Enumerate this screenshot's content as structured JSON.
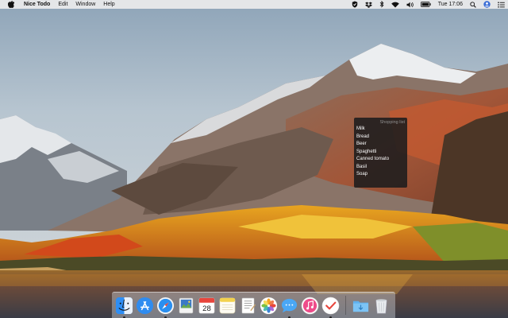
{
  "menubar": {
    "app_name": "Nice Todo",
    "menus": [
      "Edit",
      "Window",
      "Help"
    ],
    "clock": "Tue 17:06",
    "status_icons": [
      "shield-icon",
      "dropbox-icon",
      "bluetooth-icon",
      "wifi-icon",
      "volume-icon",
      "battery-icon",
      "spotlight-icon",
      "user-icon",
      "notification-center-icon"
    ]
  },
  "widget": {
    "title": "Shopping list",
    "items": [
      "Milk",
      "Bread",
      "Beer",
      "Spaghetti",
      "Canned tomato",
      "Basil",
      "Soap"
    ]
  },
  "dock": {
    "apps": [
      "finder-icon",
      "app-store-icon",
      "safari-icon",
      "preview-icon",
      "calendar-icon",
      "notes-icon",
      "textedit-icon",
      "photos-icon",
      "messages-icon",
      "itunes-icon",
      "nice-todo-icon"
    ],
    "calendar_day": "28",
    "folders": [
      "downloads-folder-icon",
      "trash-icon"
    ]
  },
  "colors": {
    "widget_bg": "#1c1c1e",
    "menubar_bg": "#ececec",
    "accent_red": "#e8453c"
  }
}
